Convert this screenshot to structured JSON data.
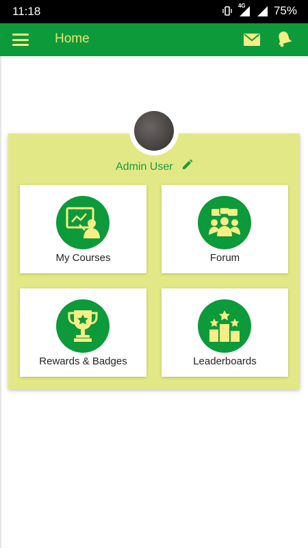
{
  "status_bar": {
    "time": "11:18",
    "network": "4G",
    "battery": "75%"
  },
  "app_bar": {
    "title": "Home"
  },
  "profile": {
    "name": "Admin User"
  },
  "tiles": [
    {
      "label": "My Courses",
      "icon": "presentation-icon"
    },
    {
      "label": "Forum",
      "icon": "group-chat-icon"
    },
    {
      "label": "Rewards & Badges",
      "icon": "trophy-icon"
    },
    {
      "label": "Leaderboards",
      "icon": "podium-icon"
    }
  ],
  "colors": {
    "primary": "#0c9a3a",
    "accent": "#e2e886",
    "icon_fill": "#f7ef86",
    "title_text": "#eae673"
  }
}
